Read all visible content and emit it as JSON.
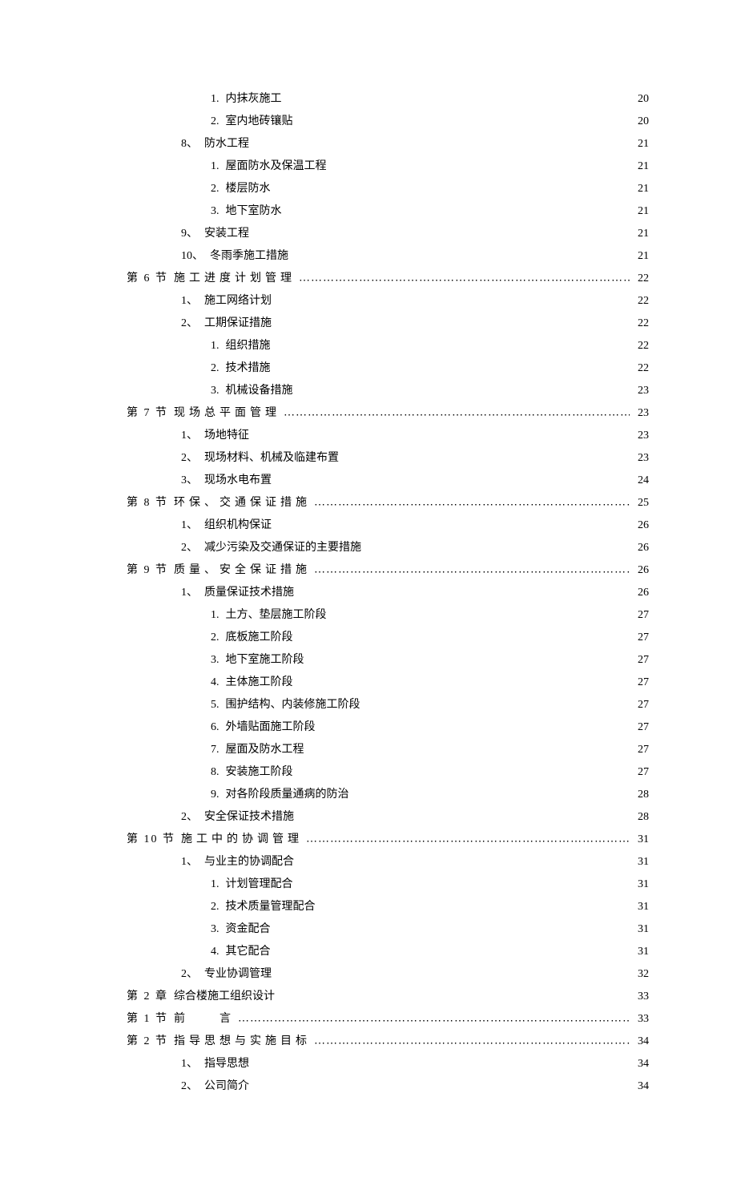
{
  "toc": [
    {
      "level": 3,
      "num": "1.",
      "title": "内抹灰施工",
      "page": "20",
      "leader": "dense"
    },
    {
      "level": 3,
      "num": "2.",
      "title": "室内地砖镶贴",
      "page": "20",
      "leader": "dense"
    },
    {
      "level": 2,
      "num": "8、",
      "title": "防水工程",
      "page": "21",
      "leader": "dense"
    },
    {
      "level": 3,
      "num": "1.",
      "title": "屋面防水及保温工程",
      "page": "21",
      "leader": "dense"
    },
    {
      "level": 3,
      "num": "2.",
      "title": "楼层防水",
      "page": "21",
      "leader": "dense"
    },
    {
      "level": 3,
      "num": "3.",
      "title": "地下室防水",
      "page": "21",
      "leader": "dense"
    },
    {
      "level": 2,
      "num": "9、",
      "title": "安装工程",
      "page": "21",
      "leader": "dense"
    },
    {
      "level": 2,
      "num": "10、",
      "title": "冬雨季施工措施",
      "page": "21",
      "leader": "dense"
    },
    {
      "level": 1,
      "num": "第 6 节",
      "title": "施工进度计划管理",
      "page": "22",
      "leader": "sparse",
      "spaced": true
    },
    {
      "level": 2,
      "num": "1、",
      "title": "施工网络计划",
      "page": "22",
      "leader": "dense"
    },
    {
      "level": 2,
      "num": "2、",
      "title": "工期保证措施",
      "page": "22",
      "leader": "dense"
    },
    {
      "level": 3,
      "num": "1.",
      "title": "组织措施",
      "page": "22",
      "leader": "dense"
    },
    {
      "level": 3,
      "num": "2.",
      "title": "技术措施",
      "page": "22",
      "leader": "dense"
    },
    {
      "level": 3,
      "num": "3.",
      "title": "机械设备措施",
      "page": "23",
      "leader": "dense"
    },
    {
      "level": 1,
      "num": "第 7 节",
      "title": "现场总平面管理",
      "page": "23",
      "leader": "sparse",
      "spaced": true
    },
    {
      "level": 2,
      "num": "1、",
      "title": "场地特征",
      "page": "23",
      "leader": "dense"
    },
    {
      "level": 2,
      "num": "2、",
      "title": "现场材料、机械及临建布置",
      "page": "23",
      "leader": "dense"
    },
    {
      "level": 2,
      "num": "3、",
      "title": "现场水电布置",
      "page": "24",
      "leader": "dense"
    },
    {
      "level": 1,
      "num": "第 8 节",
      "title": "环保、交通保证措施",
      "page": "25",
      "leader": "sparse",
      "spaced": true
    },
    {
      "level": 2,
      "num": "1、",
      "title": "组织机构保证",
      "page": "26",
      "leader": "dense"
    },
    {
      "level": 2,
      "num": "2、",
      "title": "减少污染及交通保证的主要措施",
      "page": "26",
      "leader": "dense"
    },
    {
      "level": 1,
      "num": "第 9 节",
      "title": "质量、安全保证措施",
      "page": "26",
      "leader": "sparse",
      "spaced": true
    },
    {
      "level": 2,
      "num": "1、",
      "title": "质量保证技术措施",
      "page": "26",
      "leader": "dense"
    },
    {
      "level": 3,
      "num": "1.",
      "title": "土方、垫层施工阶段",
      "page": "27",
      "leader": "dense"
    },
    {
      "level": 3,
      "num": "2.",
      "title": "底板施工阶段",
      "page": "27",
      "leader": "dense"
    },
    {
      "level": 3,
      "num": "3.",
      "title": "地下室施工阶段",
      "page": "27",
      "leader": "dense"
    },
    {
      "level": 3,
      "num": "4.",
      "title": "主体施工阶段",
      "page": "27",
      "leader": "dense"
    },
    {
      "level": 3,
      "num": "5.",
      "title": "围护结构、内装修施工阶段",
      "page": "27",
      "leader": "dense"
    },
    {
      "level": 3,
      "num": "6.",
      "title": "外墙贴面施工阶段",
      "page": "27",
      "leader": "dense"
    },
    {
      "level": 3,
      "num": "7.",
      "title": "屋面及防水工程",
      "page": "27",
      "leader": "dense"
    },
    {
      "level": 3,
      "num": "8.",
      "title": "安装施工阶段",
      "page": "27",
      "leader": "dense"
    },
    {
      "level": 3,
      "num": "9.",
      "title": "对各阶段质量通病的防治",
      "page": "28",
      "leader": "dense"
    },
    {
      "level": 2,
      "num": "2、",
      "title": "安全保证技术措施",
      "page": "28",
      "leader": "dense"
    },
    {
      "level": 1,
      "num": "第 10 节",
      "title": " 施工中的协调管理",
      "page": "31",
      "leader": "sparse",
      "spaced": true
    },
    {
      "level": 2,
      "num": "1、",
      "title": "与业主的协调配合",
      "page": "31",
      "leader": "dense"
    },
    {
      "level": 3,
      "num": "1.",
      "title": "计划管理配合",
      "page": "31",
      "leader": "dense"
    },
    {
      "level": 3,
      "num": "2.",
      "title": "技术质量管理配合",
      "page": "31",
      "leader": "dense"
    },
    {
      "level": 3,
      "num": "3.",
      "title": "资金配合",
      "page": "31",
      "leader": "dense"
    },
    {
      "level": 3,
      "num": "4.",
      "title": "其它配合",
      "page": "31",
      "leader": "dense"
    },
    {
      "level": 2,
      "num": "2、",
      "title": "专业协调管理",
      "page": "32",
      "leader": "dense"
    },
    {
      "level": 0,
      "num": "第 2 章",
      "title": " 综合楼施工组织设计",
      "page": "33",
      "leader": "dense"
    },
    {
      "level": 1,
      "num": "第 1 节",
      "title": "前　　言",
      "page": "33",
      "leader": "sparse",
      "spaced": true
    },
    {
      "level": 1,
      "num": "第 2 节",
      "title": "指导思想与实施目标",
      "page": "34",
      "leader": "sparse",
      "spaced": true
    },
    {
      "level": 2,
      "num": "1、",
      "title": "指导思想",
      "page": "34",
      "leader": "dense"
    },
    {
      "level": 2,
      "num": "2、",
      "title": "公司简介",
      "page": "34",
      "leader": "dense"
    }
  ]
}
